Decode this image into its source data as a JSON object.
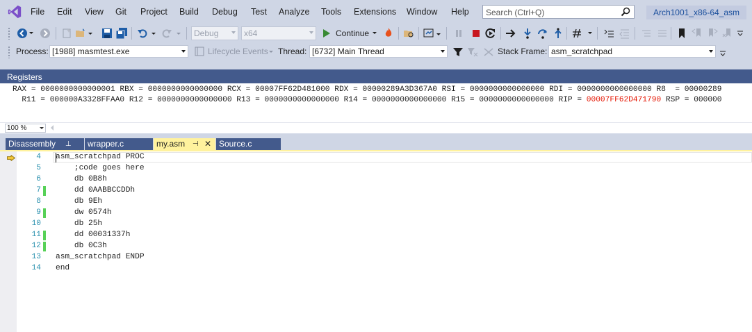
{
  "menubar": {
    "items": [
      "File",
      "Edit",
      "View",
      "Git",
      "Project",
      "Build",
      "Debug",
      "Test",
      "Analyze",
      "Tools",
      "Extensions",
      "Window",
      "Help"
    ],
    "search_placeholder": "Search (Ctrl+Q)",
    "solution_name": "Arch1001_x86-64_asm"
  },
  "toolbar": {
    "config": "Debug",
    "platform": "x64",
    "continue_label": "Continue"
  },
  "debug_location": {
    "process_label": "Process:",
    "process_value": "[1988] masmtest.exe",
    "lifecycle_label": "Lifecycle Events",
    "thread_label": "Thread:",
    "thread_value": "[6732] Main Thread",
    "stack_frame_label": "Stack Frame:",
    "stack_frame_value": "asm_scratchpad"
  },
  "registers": {
    "title": "Registers",
    "line1": "RAX = 0000000000000001 RBX = 0000000000000000 RCX = 00007FF62D481000 RDX = 00000289A3D367A0 RSI = 0000000000000000 RDI = 0000000000000000 R8  = 00000289",
    "line2_pre": "  R11 = 000000A3328FFAA0 R12 = 0000000000000000 R13 = 0000000000000000 R14 = 0000000000000000 R15 = 0000000000000000 RIP = ",
    "line2_red": "00007FF62D471790",
    "line2_post": " RSP = 000000"
  },
  "zoom": "100 %",
  "tabs": [
    {
      "label": "Disassembly",
      "pin": "⊥"
    },
    {
      "label": "wrapper.c"
    },
    {
      "label": "my.asm",
      "pin": "⊣",
      "close": "✕"
    },
    {
      "label": "Source.c"
    }
  ],
  "code_lines": [
    {
      "num": "4",
      "text": "asm_scratchpad PROC"
    },
    {
      "num": "5",
      "text": "    ;code goes here"
    },
    {
      "num": "6",
      "text": "    db 0B8h"
    },
    {
      "num": "7",
      "text": "    dd 0AABBCCDDh"
    },
    {
      "num": "8",
      "text": "    db 9Eh"
    },
    {
      "num": "9",
      "text": "    dw 0574h"
    },
    {
      "num": "10",
      "text": "    db 25h"
    },
    {
      "num": "11",
      "text": "    dd 00031337h"
    },
    {
      "num": "12",
      "text": "    db 0C3h"
    },
    {
      "num": "13",
      "text": "asm_scratchpad ENDP"
    },
    {
      "num": "14",
      "text": "end"
    }
  ],
  "colors": {
    "accent": "#435a8c",
    "active_tab": "#fff29d",
    "line_number": "#2b91af",
    "changed_marker": "#57d157",
    "register_changed": "#e51400"
  }
}
